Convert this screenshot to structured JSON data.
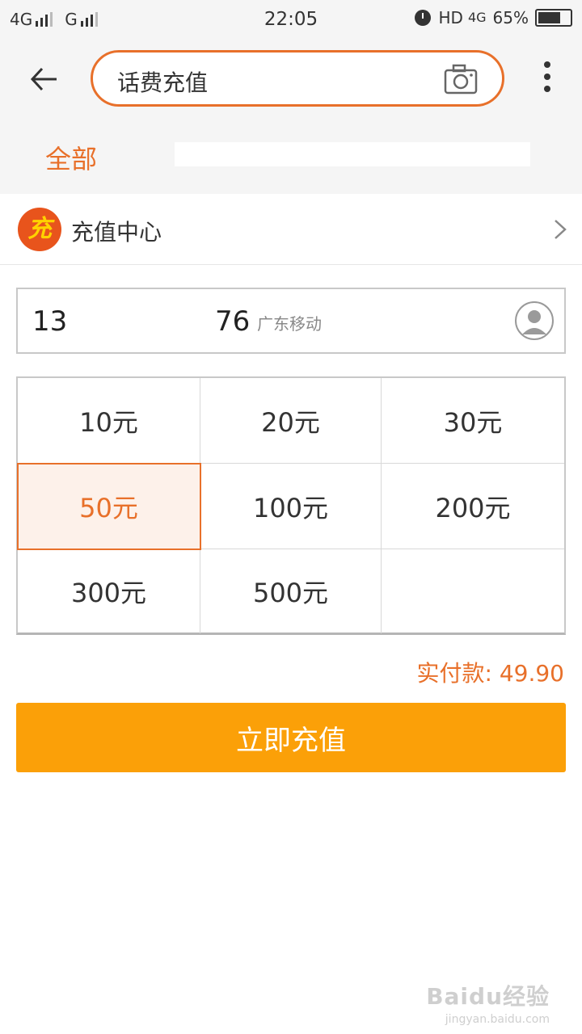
{
  "status_bar": {
    "network1": "4G",
    "network2": "G",
    "time": "22:05",
    "hd": "HD",
    "net4g": "4G",
    "battery": "65%"
  },
  "header": {
    "search_text": "话费充值",
    "tab_all": "全部"
  },
  "recharge_center": {
    "logo_char": "充",
    "title": "充值中心"
  },
  "phone": {
    "prefix": "13",
    "suffix": "76",
    "carrier": "广东移动"
  },
  "amounts": [
    {
      "label": "10元"
    },
    {
      "label": "20元"
    },
    {
      "label": "30元"
    },
    {
      "label": "50元"
    },
    {
      "label": "100元"
    },
    {
      "label": "200元"
    },
    {
      "label": "300元"
    },
    {
      "label": "500元"
    },
    {
      "label": ""
    }
  ],
  "selected_amount": "50元",
  "payment": {
    "label": "实付款:",
    "amount": "49.90"
  },
  "recharge_button": "立即充值",
  "watermark": {
    "main": "Baidu经验",
    "url": "jingyan.baidu.com"
  },
  "colors": {
    "accent": "#e8702a",
    "button": "#fba008",
    "selected_bg": "#fdf1ea"
  },
  "icons": [
    "back-arrow-icon",
    "camera-icon",
    "more-icon",
    "chevron-right-icon",
    "contact-icon",
    "alarm-icon",
    "battery-icon",
    "signal-icon"
  ]
}
